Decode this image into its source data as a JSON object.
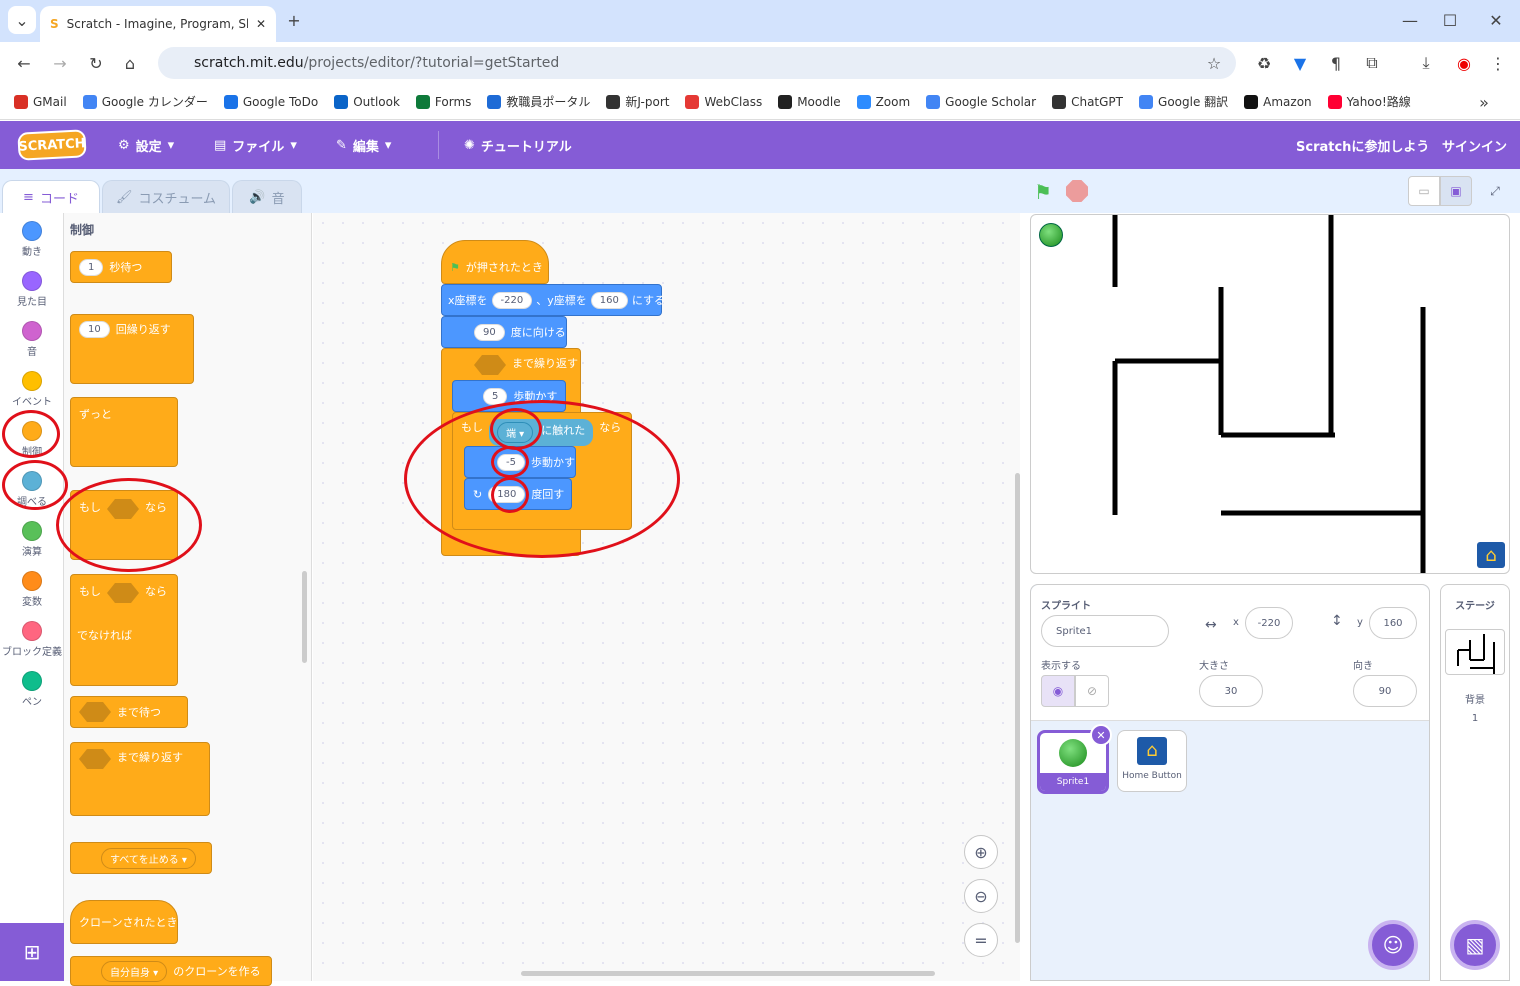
{
  "browser": {
    "tab_title": "Scratch - Imagine, Program, Sha",
    "url_host": "scratch.mit.edu",
    "url_path": "/projects/editor/?tutorial=getStarted"
  },
  "bookmarks": [
    {
      "label": "GMail",
      "color": "#d93025"
    },
    {
      "label": "Google カレンダー",
      "color": "#4285f4"
    },
    {
      "label": "Google ToDo",
      "color": "#1a73e8"
    },
    {
      "label": "Outlook",
      "color": "#0a64c8"
    },
    {
      "label": "Forms",
      "color": "#0e7a3a"
    },
    {
      "label": "教職員ポータル",
      "color": "#1e6bd6"
    },
    {
      "label": "新J-port",
      "color": "#333333"
    },
    {
      "label": "WebClass",
      "color": "#e53935"
    },
    {
      "label": "Moodle",
      "color": "#222222"
    },
    {
      "label": "Zoom",
      "color": "#2d8cff"
    },
    {
      "label": "Google Scholar",
      "color": "#4285f4"
    },
    {
      "label": "ChatGPT",
      "color": "#333333"
    },
    {
      "label": "Google 翻訳",
      "color": "#4285f4"
    },
    {
      "label": "Amazon",
      "color": "#111111"
    },
    {
      "label": "Yahoo!路線",
      "color": "#ff0033"
    }
  ],
  "menu": {
    "logo": "SCRATCH",
    "settings": "設定",
    "file": "ファイル",
    "edit": "編集",
    "tutorial": "チュートリアル",
    "join": "Scratchに参加しよう",
    "signin": "サインイン"
  },
  "tabs": {
    "code": "コード",
    "costume": "コスチューム",
    "sound": "音"
  },
  "categories": [
    {
      "label": "動き",
      "color": "#4c97ff"
    },
    {
      "label": "見た目",
      "color": "#9966ff"
    },
    {
      "label": "音",
      "color": "#cf63cf"
    },
    {
      "label": "イベント",
      "color": "#ffbf00"
    },
    {
      "label": "制御",
      "color": "#ffab19"
    },
    {
      "label": "調べる",
      "color": "#5cb1d6"
    },
    {
      "label": "演算",
      "color": "#59c059"
    },
    {
      "label": "変数",
      "color": "#ff8c1a"
    },
    {
      "label": "ブロック定義",
      "color": "#ff6680"
    },
    {
      "label": "ペン",
      "color": "#0fbd8c"
    }
  ],
  "palette": {
    "heading": "制御",
    "wait": "秒待つ",
    "wait_val": "1",
    "repeat": "回繰り返す",
    "repeat_val": "10",
    "forever": "ずっと",
    "if": "もし",
    "then": "なら",
    "else": "でなければ",
    "waituntil": "まで待つ",
    "repeatuntil": "まで繰り返す",
    "stop": "すべてを止める ▾",
    "clone_start": "クローンされたとき",
    "clone_self": "自分自身 ▾",
    "clone_make": "のクローンを作る"
  },
  "script": {
    "hat": "が押されたとき",
    "goto_x": "x座標を",
    "goto_xval": "-220",
    "goto_y": "、y座標を",
    "goto_yval": "160",
    "goto_end": "にする",
    "point_val": "90",
    "point": "度に向ける",
    "until": "まで繰り返す",
    "move_val": "5",
    "move": "歩動かす",
    "if": "もし",
    "touch_val": "端 ▾",
    "touch": "に触れた",
    "then": "なら",
    "back_val": "-5",
    "back": "歩動かす",
    "turn_val": "180",
    "turn": "度回す"
  },
  "sprite": {
    "label": "スプライト",
    "name": "Sprite1",
    "x": "-220",
    "y": "160",
    "show": "表示する",
    "size_label": "大きさ",
    "size": "30",
    "dir_label": "向き",
    "dir": "90"
  },
  "sprites": [
    "Sprite1",
    "Home Button"
  ],
  "stagepane": {
    "title": "ステージ",
    "bg_label": "背景",
    "bg_count": "1"
  }
}
